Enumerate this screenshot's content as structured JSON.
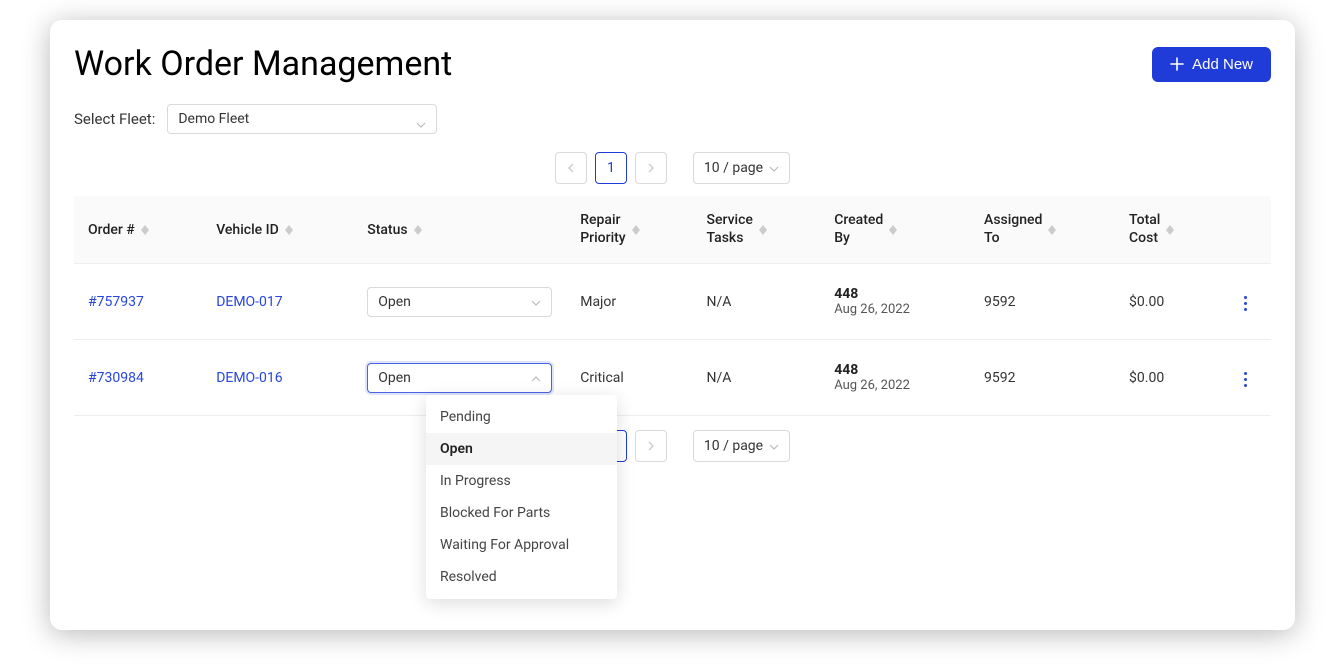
{
  "header": {
    "title": "Work Order Management",
    "add_btn": "Add New"
  },
  "fleet": {
    "label": "Select Fleet:",
    "value": "Demo Fleet"
  },
  "pager": {
    "page": "1",
    "page_size": "10 / page"
  },
  "columns": {
    "order": "Order #",
    "vehicle": "Vehicle ID",
    "status": "Status",
    "priority_l1": "Repair",
    "priority_l2": "Priority",
    "tasks_l1": "Service",
    "tasks_l2": "Tasks",
    "created_l1": "Created",
    "created_l2": "By",
    "assigned_l1": "Assigned",
    "assigned_l2": "To",
    "cost_l1": "Total",
    "cost_l2": "Cost"
  },
  "rows": [
    {
      "order": "#757937",
      "vehicle": "DEMO-017",
      "status": "Open",
      "priority": "Major",
      "tasks": "N/A",
      "created_by": "448",
      "created_date": "Aug 26, 2022",
      "assigned_to": "9592",
      "cost": "$0.00"
    },
    {
      "order": "#730984",
      "vehicle": "DEMO-016",
      "status": "Open",
      "priority": "Critical",
      "tasks": "N/A",
      "created_by": "448",
      "created_date": "Aug 26, 2022",
      "assigned_to": "9592",
      "cost": "$0.00"
    }
  ],
  "status_options": [
    "Pending",
    "Open",
    "In Progress",
    "Blocked For Parts",
    "Waiting For Approval",
    "Resolved"
  ],
  "status_selected": "Open"
}
